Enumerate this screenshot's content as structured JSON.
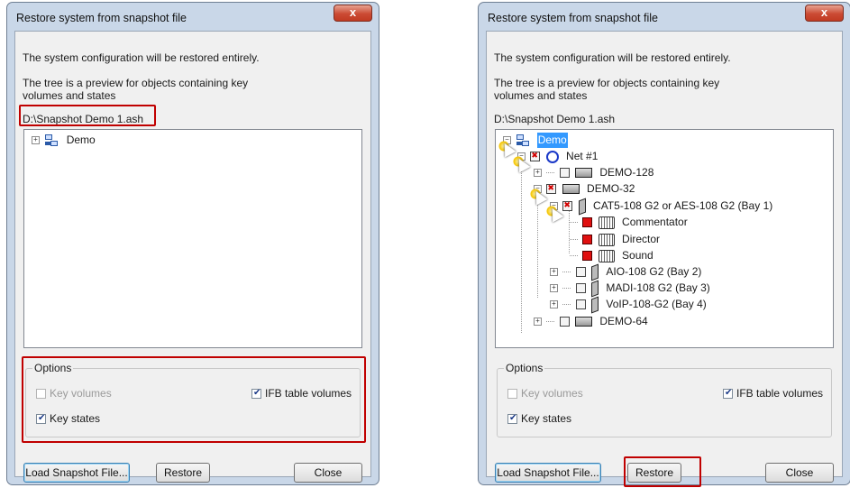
{
  "dialogs": [
    {
      "title": "Restore system from snapshot file",
      "close_label": "x",
      "message1": "The system configuration will be restored entirely.",
      "message2": "The tree is a preview for objects containing key volumes and states",
      "file_path": "D:\\Snapshot Demo 1.ash",
      "tree": {
        "root": "Demo"
      },
      "options": {
        "legend": "Options",
        "key_volumes": {
          "label": "Key volumes",
          "checked": false,
          "enabled": false
        },
        "ifb_table_volumes": {
          "label": "IFB table volumes",
          "checked": true,
          "enabled": true
        },
        "key_states": {
          "label": "Key states",
          "checked": true,
          "enabled": true
        }
      },
      "buttons": {
        "load": "Load Snapshot File...",
        "restore": "Restore",
        "close": "Close"
      }
    },
    {
      "title": "Restore system from snapshot file",
      "close_label": "x",
      "message1": "The system configuration will be restored entirely.",
      "message2": "The tree is a preview for objects containing key volumes and states",
      "file_path": "D:\\Snapshot Demo 1.ash",
      "tree": {
        "root": "Demo",
        "net": "Net #1",
        "demo128": "DEMO-128",
        "demo32": "DEMO-32",
        "cat5": "CAT5-108 G2 or AES-108 G2 (Bay  1)",
        "commentator": "Commentator",
        "director": "Director",
        "sound": "Sound",
        "aio": "AIO-108 G2 (Bay  2)",
        "madi": "MADI-108 G2 (Bay  3)",
        "voip": "VoIP-108-G2 (Bay  4)",
        "demo64": "DEMO-64"
      },
      "options": {
        "legend": "Options",
        "key_volumes": {
          "label": "Key volumes",
          "checked": false,
          "enabled": false
        },
        "ifb_table_volumes": {
          "label": "IFB table volumes",
          "checked": true,
          "enabled": true
        },
        "key_states": {
          "label": "Key states",
          "checked": true,
          "enabled": true
        }
      },
      "buttons": {
        "load": "Load Snapshot File...",
        "restore": "Restore",
        "close": "Close"
      }
    }
  ],
  "colors": {
    "highlight": "#c00000",
    "selection": "#3399ff",
    "window_frame": "#c9d7e8"
  }
}
